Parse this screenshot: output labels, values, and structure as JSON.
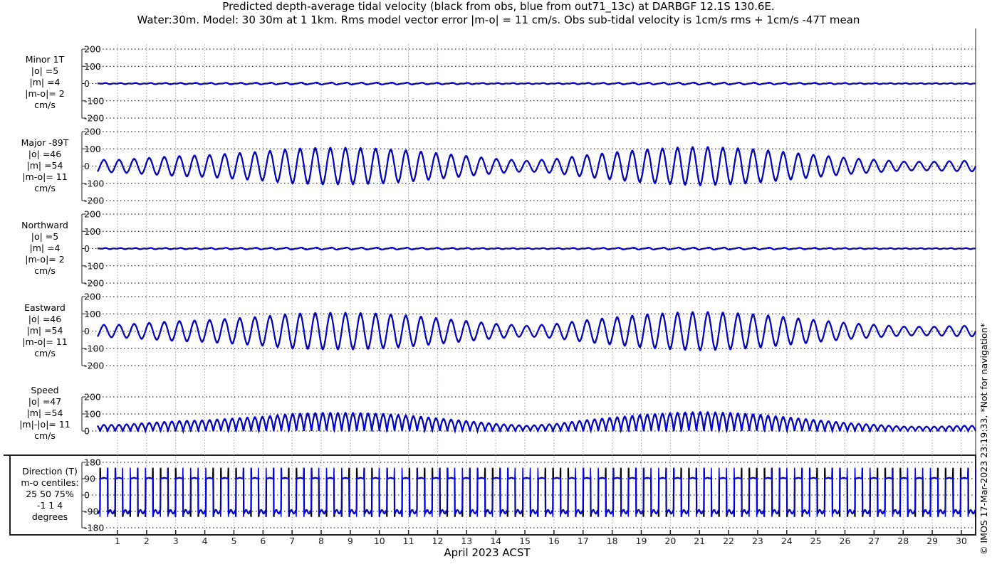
{
  "title": {
    "line1": "Predicted depth-average tidal velocity (black from obs, blue from out71_13c) at DARBGF 12.1S 130.6E.",
    "line2": "Water:30m. Model: 30 30m at 1 1km. Rms model vector error |m-o| = 11 cm/s. Obs sub-tidal velocity is 1cm/s rms + 1cm/s -47T mean"
  },
  "copyright": "© IMOS 17-Mar-2023 23:19:33. *Not for navigation*",
  "chart_data": {
    "type": "line",
    "xlabel": "April 2023 ACST",
    "x_ticks": [
      "1",
      "2",
      "3",
      "4",
      "5",
      "6",
      "7",
      "8",
      "9",
      "10",
      "11",
      "12",
      "13",
      "14",
      "15",
      "16",
      "17",
      "18",
      "19",
      "20",
      "21",
      "22",
      "23",
      "24",
      "25",
      "26",
      "27",
      "28",
      "29",
      "30"
    ],
    "xlim": [
      0.3,
      30.4
    ],
    "tidal_period_days": 0.5175,
    "colors": {
      "obs": "#000000",
      "model": "#0000ff",
      "grid_v": "#aab4dd"
    },
    "series_legend": {
      "obs": "black from obs",
      "model": "blue from out71_13c"
    },
    "major_amplitude_envelope_by_day": [
      35,
      45,
      55,
      60,
      70,
      80,
      95,
      100,
      100,
      95,
      85,
      70,
      55,
      40,
      30,
      40,
      60,
      75,
      90,
      100,
      105,
      100,
      90,
      75,
      60,
      45,
      35,
      25,
      25,
      30
    ],
    "panels": [
      {
        "id": "minor",
        "label": [
          "Minor 1T",
          "|o| =5",
          "|m| =4",
          "|m-o|= 2",
          "cm/s"
        ],
        "ylim": [
          -200,
          200
        ],
        "yticks": [
          "200",
          "100",
          "0",
          "-100",
          "-200"
        ],
        "scale": 0.05
      },
      {
        "id": "major",
        "label": [
          "Major -89T",
          "|o| =46",
          "|m| =54",
          "|m-o|= 11",
          "cm/s"
        ],
        "ylim": [
          -200,
          200
        ],
        "yticks": [
          "200",
          "100",
          "0",
          "-100",
          "-200"
        ],
        "scale": 1.0
      },
      {
        "id": "north",
        "label": [
          "Northward",
          "|o| =5",
          "|m| =4",
          "|m-o|= 2",
          "cm/s"
        ],
        "ylim": [
          -200,
          200
        ],
        "yticks": [
          "200",
          "100",
          "0",
          "-100",
          "-200"
        ],
        "scale": 0.05
      },
      {
        "id": "east",
        "label": [
          "Eastward",
          "|o| =46",
          "|m| =54",
          "|m-o|= 11",
          "cm/s"
        ],
        "ylim": [
          -200,
          200
        ],
        "yticks": [
          "200",
          "100",
          "0",
          "-100",
          "-200"
        ],
        "scale": 1.0
      },
      {
        "id": "speed",
        "label": [
          "Speed",
          "|o| =47",
          "|m| =54",
          "|m|-|o|= 11",
          "cm/s"
        ],
        "ylim": [
          0,
          200
        ],
        "yticks": [
          "200",
          "100",
          "0"
        ],
        "scale": 1.0
      },
      {
        "id": "direction",
        "label": [
          "Direction (T)",
          "m-o centiles:",
          "25  50  75%",
          "-1  1  4",
          "degrees"
        ],
        "ylim": [
          -180,
          180
        ],
        "yticks": [
          "180",
          "90",
          "0",
          "-90",
          "-180"
        ]
      }
    ]
  }
}
